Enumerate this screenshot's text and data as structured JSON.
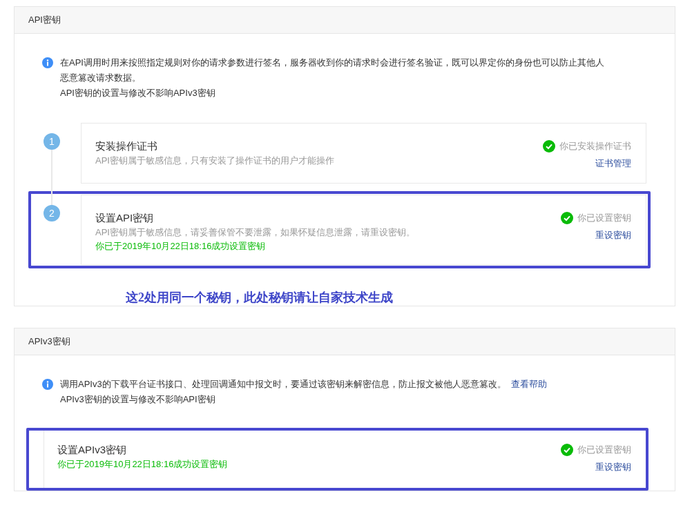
{
  "sections": [
    {
      "title": "API密钥",
      "info": [
        "在API调用时用来按照指定规则对你的请求参数进行签名，服务器收到你的请求时会进行签名验证，既可以界定你的身份也可以防止其他人恶意篡改请求数据。",
        "API密钥的设置与修改不影响APIv3密钥"
      ],
      "steps": [
        {
          "number": "1",
          "title": "安装操作证书",
          "description": "API密钥属于敏感信息，只有安装了操作证书的用户才能操作",
          "status": "你已安装操作证书",
          "done": true,
          "link": "证书管理",
          "highlighted": false
        },
        {
          "number": "2",
          "title": "设置API密钥",
          "description": "API密钥属于敏感信息，请妥善保管不要泄露，如果怀疑信息泄露，请重设密钥。",
          "success_text": "你已于2019年10月22日18:16成功设置密钥",
          "status": "你已设置密钥",
          "done": true,
          "link": "重设密钥",
          "highlighted": true
        }
      ],
      "note": "这2处用同一个秘钥，此处秘钥请让自家技术生成"
    },
    {
      "title": "APIv3密钥",
      "info": [
        "调用APIv3的下载平台证书接口、处理回调通知中报文时，要通过该密钥来解密信息，防止报文被他人恶意篡改。",
        "APIv3密钥的设置与修改不影响API密钥"
      ],
      "info_link": "查看帮助",
      "cards": [
        {
          "title": "设置APIv3密钥",
          "success_text": "你已于2019年10月22日18:16成功设置密钥",
          "status": "你已设置密钥",
          "done": true,
          "link": "重设密钥",
          "highlighted": true
        }
      ]
    }
  ]
}
